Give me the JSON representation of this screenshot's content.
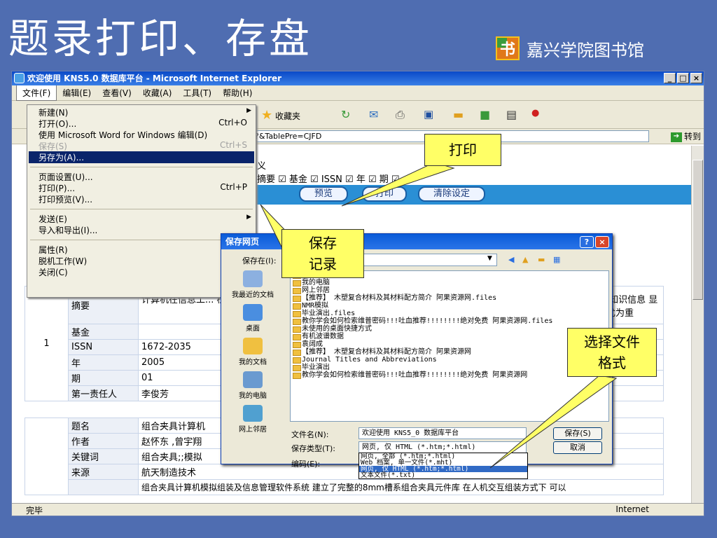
{
  "slide": {
    "title": "题录打印、存盘",
    "library": "嘉兴学院图书馆",
    "logo_char": "书"
  },
  "ie": {
    "window_title": "欢迎使用 KNS5.0 数据库平台 - Microsoft Internet Explorer",
    "win_min": "_",
    "win_max": "□",
    "win_close": "×",
    "menus": [
      "文件(F)",
      "编辑(E)",
      "查看(V)",
      "收藏(A)",
      "工具(T)",
      "帮助(H)"
    ],
    "favorites_label": "收藏夹",
    "address_tail": "?&TablePre=CJFD",
    "go_label": "转到",
    "status": "完毕",
    "zone": "Internet"
  },
  "file_menu": {
    "items": [
      {
        "label": "新建(N)",
        "shortcut": "",
        "submenu": true
      },
      {
        "label": "打开(O)...",
        "shortcut": "Ctrl+O"
      },
      {
        "label": "使用 Microsoft Word for Windows 编辑(D)",
        "shortcut": ""
      },
      {
        "label": "保存(S)",
        "shortcut": "Ctrl+S",
        "disabled": true
      },
      {
        "label": "另存为(A)...",
        "shortcut": "",
        "selected": true
      },
      {
        "label": "页面设置(U)...",
        "shortcut": ""
      },
      {
        "label": "打印(P)...",
        "shortcut": "Ctrl+P"
      },
      {
        "label": "打印预览(V)...",
        "shortcut": ""
      },
      {
        "label": "发送(E)",
        "shortcut": "",
        "submenu": true
      },
      {
        "label": "导入和导出(I)...",
        "shortcut": ""
      },
      {
        "label": "属性(R)",
        "shortcut": ""
      },
      {
        "label": "脱机工作(W)",
        "shortcut": ""
      },
      {
        "label": "关闭(C)",
        "shortcut": ""
      }
    ]
  },
  "page": {
    "definition_tail": "义",
    "field_checks": "摘要 ☑ 基金 ☑ ISSN ☑ 年 ☑ 期 ☑",
    "buttons": {
      "preview": "预览",
      "print": "打印",
      "clear": "清除设定"
    },
    "record1": {
      "index": "1",
      "rows": [
        {
          "label": "摘要",
          "value": "计算机在信息工... 检索和利用基地... 要。",
          "tail": ",是知识信息 显得尤为重"
        },
        {
          "label": "基金",
          "value": ""
        },
        {
          "label": "ISSN",
          "value": "1672-2035"
        },
        {
          "label": "年",
          "value": "2005"
        },
        {
          "label": "期",
          "value": "01"
        },
        {
          "label": "第一责任人",
          "value": "李俊芳"
        }
      ]
    },
    "record2": {
      "rows": [
        {
          "label": "题名",
          "value": "组合夹具计算机"
        },
        {
          "label": "作者",
          "value": "赵怀东 ,曾宇翔"
        },
        {
          "label": "关键词",
          "value": "组合夹具;;模拟"
        },
        {
          "label": "来源",
          "value": "航天制造技术"
        }
      ],
      "abstract_line": "组合夹具计算机模拟组装及信息管理软件系统 建立了完整的8mm槽系组合夹具元件库 在人机交互组装方式下 可以"
    }
  },
  "save_dialog": {
    "title": "保存网页",
    "save_in_label": "保存在(I):",
    "sidebar": [
      "我最近的文档",
      "桌面",
      "我的文档",
      "我的电脑",
      "网上邻居"
    ],
    "files": [
      "我的文档",
      "我的电脑",
      "网上邻居",
      "【推荐】 木塑复合材料及其材料配方简介 阿果资源网.files",
      "NMR模拟",
      "毕业演出.files",
      "教你学会如何检索维普密码!!!吐血推荐!!!!!!!!绝对免费 阿果资源网.files",
      "未使用的桌面快捷方式",
      "有机波谱数据",
      "袁阔成",
      "【推荐】 木塑复合材料及其材料配方简介 阿果资源网",
      "Journal Titles and Abbreviations",
      "毕业演出",
      "教你学会如何检索维普密码!!!吐血推荐!!!!!!!!绝对免费 阿果资源网"
    ],
    "filename_label": "文件名(N):",
    "filename_value": "欢迎使用 KNS5_0 数据库平台",
    "type_label": "保存类型(T):",
    "type_value": "网页, 仅 HTML (*.htm;*.html)",
    "encoding_label": "编码(E):",
    "save_button": "保存(S)",
    "cancel_button": "取消",
    "type_options": [
      "网页, 全部 (*.htm;*.html)",
      "Web 档案, 单一文件(*.mht)",
      "网页, 仅 HTML (*.htm;*.html)",
      "文本文件(*.txt)"
    ]
  },
  "callouts": {
    "print": "打印",
    "save": "保存\n记录",
    "format": "选择文件\n格式"
  }
}
